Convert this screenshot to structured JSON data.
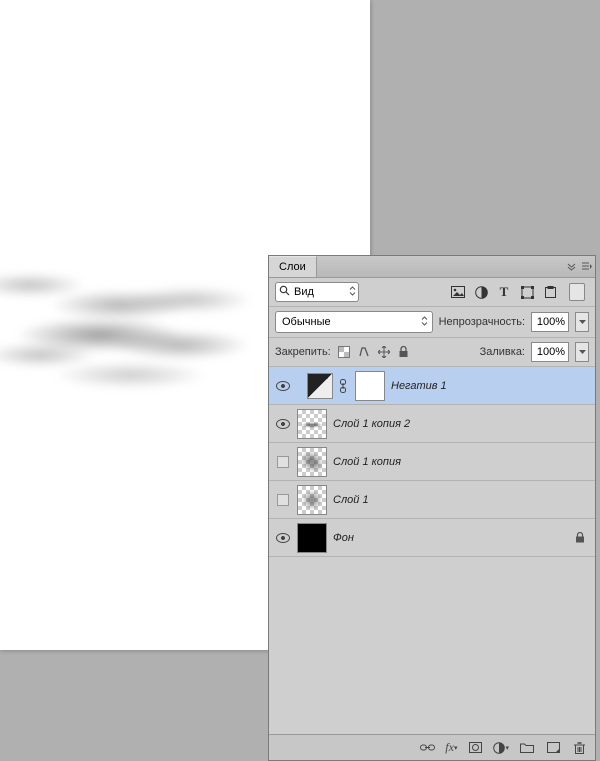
{
  "panel": {
    "title": "Слои"
  },
  "search": {
    "label": "Вид"
  },
  "filters": {
    "pixel": "pixel-filter",
    "adjustment": "adjustment-filter",
    "type": "type-filter",
    "shape": "shape-filter",
    "smart": "smart-filter"
  },
  "blend": {
    "mode": "Обычные",
    "opacity_label": "Непрозрачность:",
    "opacity_value": "100%"
  },
  "lock": {
    "label": "Закрепить:",
    "fill_label": "Заливка:",
    "fill_value": "100%"
  },
  "layers": [
    {
      "name": "Негатив 1",
      "visible": true,
      "type": "adjustment",
      "selected": true,
      "locked": false
    },
    {
      "name": "Слой 1 копия 2",
      "visible": true,
      "type": "smoke",
      "selected": false,
      "locked": false
    },
    {
      "name": "Слой 1 копия",
      "visible": false,
      "type": "dust1",
      "selected": false,
      "locked": false
    },
    {
      "name": "Слой 1",
      "visible": false,
      "type": "dust2",
      "selected": false,
      "locked": false
    },
    {
      "name": "Фон",
      "visible": true,
      "type": "black",
      "selected": false,
      "locked": true
    }
  ],
  "footer": {
    "link": "link",
    "fx": "fx",
    "mask": "mask",
    "adjust": "adjust",
    "group": "group",
    "new": "new",
    "trash": "trash"
  }
}
